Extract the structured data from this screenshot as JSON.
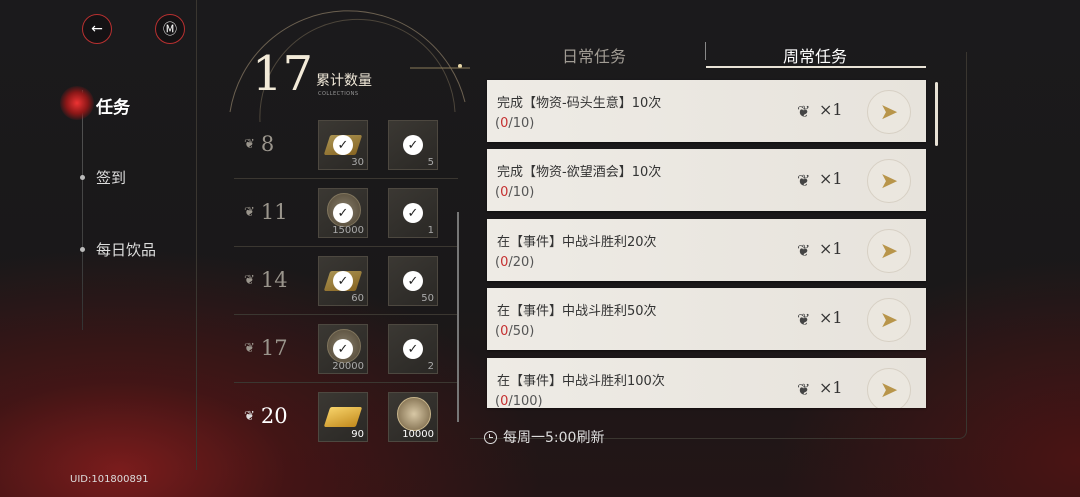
{
  "header": {
    "back_icon": "←",
    "menu_icon": "Ⓜ"
  },
  "nav": {
    "items": [
      {
        "label": "任务",
        "active": true
      },
      {
        "label": "签到",
        "active": false
      },
      {
        "label": "每日饮品",
        "active": false
      }
    ]
  },
  "uid": "UID:101800891",
  "collections": {
    "count": "17",
    "label": "累计数量",
    "sub_label": "COLLECTIONS",
    "tiers": [
      {
        "threshold": "8",
        "items": [
          {
            "count": "30",
            "claimed": true,
            "kind": "gold"
          },
          {
            "count": "5",
            "claimed": true,
            "kind": "feather"
          }
        ]
      },
      {
        "threshold": "11",
        "items": [
          {
            "count": "15000",
            "claimed": true,
            "kind": "coin"
          },
          {
            "count": "1",
            "claimed": true,
            "kind": "misc"
          }
        ]
      },
      {
        "threshold": "14",
        "items": [
          {
            "count": "60",
            "claimed": true,
            "kind": "gold"
          },
          {
            "count": "50",
            "claimed": true,
            "kind": "card"
          }
        ]
      },
      {
        "threshold": "17",
        "items": [
          {
            "count": "20000",
            "claimed": true,
            "kind": "coin"
          },
          {
            "count": "2",
            "claimed": true,
            "kind": "misc"
          }
        ]
      },
      {
        "threshold": "20",
        "items": [
          {
            "count": "90",
            "claimed": false,
            "kind": "gold"
          },
          {
            "count": "10000",
            "claimed": false,
            "kind": "coin"
          }
        ]
      }
    ]
  },
  "tabs": {
    "daily": "日常任务",
    "weekly": "周常任务"
  },
  "tasks": [
    {
      "title": "完成【物资-码头生意】10次",
      "prog_open": "(",
      "prog_cur": "0",
      "prog_rest": "/10)",
      "reward_qty": "×1"
    },
    {
      "title": "完成【物资-欲望酒会】10次",
      "prog_open": "(",
      "prog_cur": "0",
      "prog_rest": "/10)",
      "reward_qty": "×1"
    },
    {
      "title": "在【事件】中战斗胜利20次",
      "prog_open": "(",
      "prog_cur": "0",
      "prog_rest": "/20)",
      "reward_qty": "×1"
    },
    {
      "title": "在【事件】中战斗胜利50次",
      "prog_open": "(",
      "prog_cur": "0",
      "prog_rest": "/50)",
      "reward_qty": "×1"
    },
    {
      "title": "在【事件】中战斗胜利100次",
      "prog_open": "(",
      "prog_cur": "0",
      "prog_rest": "/100)",
      "reward_qty": "×1"
    }
  ],
  "refresh_text": "每周一5:00刷新",
  "colors": {
    "accent_red": "#c53030",
    "gold": "#b8954a"
  }
}
